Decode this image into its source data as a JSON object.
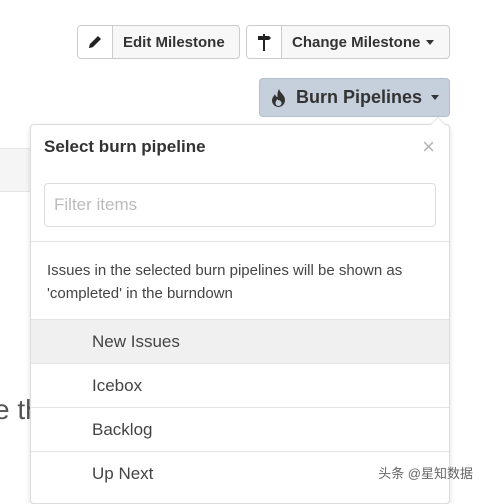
{
  "toolbar": {
    "edit_label": "Edit Milestone",
    "change_label": "Change Milestone",
    "burn_label": "Burn Pipelines",
    "edit_icon": "pencil-icon",
    "change_icon": "signpost-icon",
    "burn_icon": "flame-icon"
  },
  "background": {
    "partial_text": "e th"
  },
  "dropdown": {
    "title": "Select burn pipeline",
    "close_glyph": "×",
    "filter_placeholder": "Filter items",
    "filter_value": "",
    "description": "Issues in the selected burn pipelines will be shown as 'completed' in the burndown",
    "items": [
      {
        "label": "New Issues",
        "highlighted": true
      },
      {
        "label": "Icebox",
        "highlighted": false
      },
      {
        "label": "Backlog",
        "highlighted": false
      },
      {
        "label": "Up Next",
        "highlighted": false
      }
    ]
  },
  "watermark": "头条 @星知数据",
  "colors": {
    "burn_button_bg": "#c6d0dc",
    "button_bg": "#f7f7f7",
    "highlight_row": "#f0f0f0",
    "border": "#cccccc"
  }
}
